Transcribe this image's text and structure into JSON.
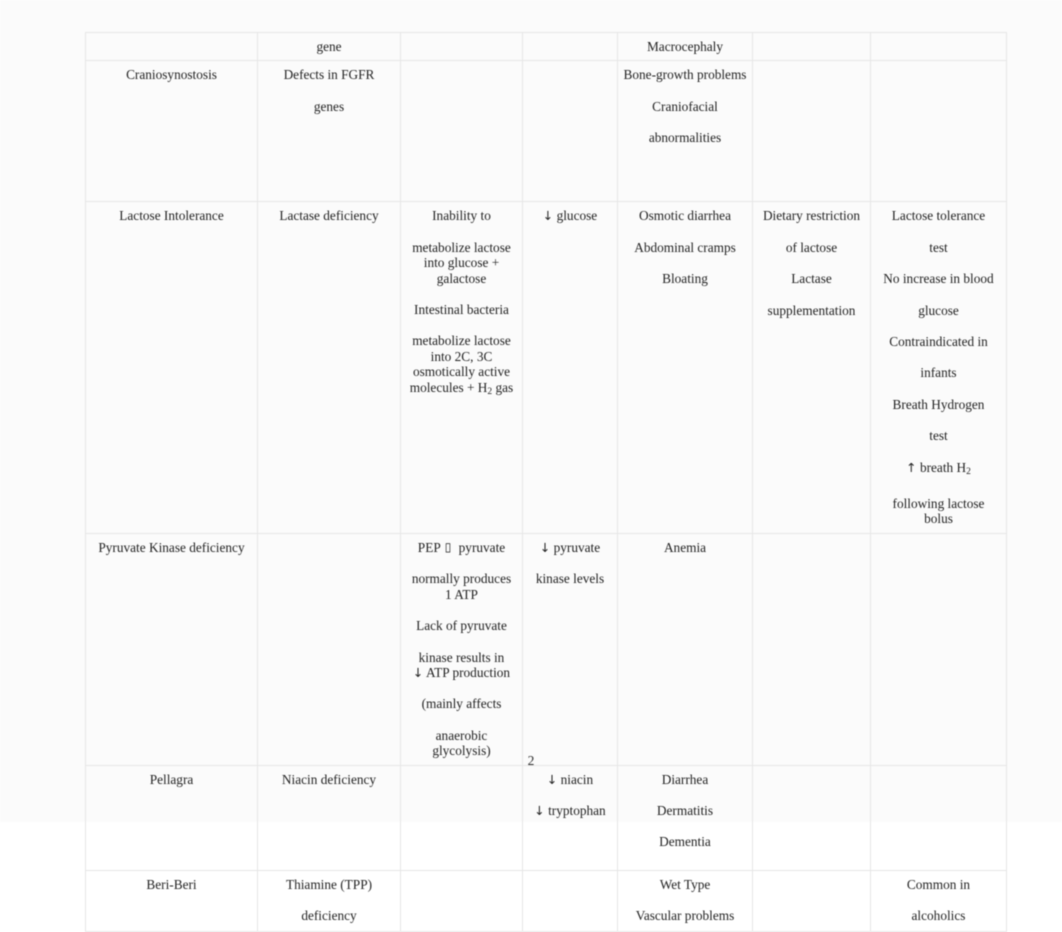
{
  "document": {
    "page_number": "2",
    "table": {
      "columns": [
        "disease",
        "cause",
        "mechanism",
        "labs",
        "signs-symptoms",
        "treatment",
        "spacer",
        "notes"
      ],
      "rows": [
        {
          "name": "row-partial-top",
          "cells": {
            "disease": [],
            "cause": [
              "gene"
            ],
            "mechanism": [],
            "labs": [],
            "signs": [
              "Macrocephaly"
            ],
            "treatment": [],
            "spacer": [],
            "notes": []
          }
        },
        {
          "name": "row-craniosynostosis",
          "cells": {
            "disease": [
              "Craniosynostosis"
            ],
            "cause": [
              "Defects in FGFR genes"
            ],
            "mechanism": [],
            "labs": [],
            "signs": [
              "Bone-growth problems",
              "Craniofacial abnormalities"
            ],
            "treatment": [],
            "spacer": [],
            "notes": []
          }
        },
        {
          "name": "row-lactose-intolerance",
          "cells": {
            "disease": [
              "Lactose Intolerance"
            ],
            "cause": [
              "Lactase deficiency"
            ],
            "mechanism": [
              "Inability to metabolize lactose into glucose + galactose",
              "Intestinal bacteria metabolize lactose into 2C, 3C osmotically active molecules + H2 gas"
            ],
            "labs": [
              "↓ glucose"
            ],
            "signs": [
              "Osmotic diarrhea",
              "Abdominal cramps",
              "Bloating"
            ],
            "treatment": [
              "Dietary restriction of lactose",
              "Lactase supplementation"
            ],
            "spacer": [],
            "notes": [
              "Lactose tolerance test",
              "No increase in blood glucose",
              "Contraindicated in infants",
              "Breath Hydrogen test",
              "↑ breath H2 following lactose bolus"
            ]
          }
        },
        {
          "name": "row-pyruvate-kinase-deficiency",
          "cells": {
            "disease": [
              "Pyruvate Kinase deficiency"
            ],
            "cause": [],
            "mechanism": [
              "PEP → pyruvate normally produces 1 ATP",
              "Lack of pyruvate kinase results in ↓ ATP production",
              "(mainly affects anaerobic glycolysis)"
            ],
            "labs": [
              "↓ pyruvate kinase levels"
            ],
            "signs": [
              "Anemia"
            ],
            "treatment": [],
            "spacer": [],
            "notes": []
          }
        },
        {
          "name": "row-pellagra",
          "cells": {
            "disease": [
              "Pellagra"
            ],
            "cause": [
              "Niacin deficiency"
            ],
            "mechanism": [],
            "labs": [
              "↓ niacin",
              "↓ tryptophan"
            ],
            "signs": [
              "Diarrhea",
              "Dermatitis",
              "Dementia"
            ],
            "treatment": [],
            "spacer": [],
            "notes": []
          }
        },
        {
          "name": "row-beri-beri",
          "cells": {
            "disease": [
              "Beri-Beri"
            ],
            "cause": [
              "Thiamine (TPP) deficiency"
            ],
            "mechanism": [],
            "labs": [],
            "signs": [
              "Wet Type",
              "Vascular problems"
            ],
            "treatment": [],
            "spacer": [],
            "notes": [
              "Common in alcoholics"
            ]
          }
        }
      ]
    },
    "text": {
      "gene": "gene",
      "macrocephaly": "Macrocephaly",
      "craniosynostosis": "Craniosynostosis",
      "defects_fgfr_l1": "Defects in FGFR",
      "defects_fgfr_l2": "genes",
      "bone_growth": "Bone-growth problems",
      "craniofacial_l1": "Craniofacial",
      "craniofacial_l2": "abnormalities",
      "lactose_intolerance": "Lactose Intolerance",
      "lactase_deficiency": "Lactase deficiency",
      "inability_l1": "Inability to",
      "inability_l2": "metabolize lactose",
      "inability_l3": "into glucose +",
      "inability_l4": "galactose",
      "bacteria_l1": "Intestinal bacteria",
      "bacteria_l2": "metabolize lactose",
      "bacteria_l3": "into 2C, 3C",
      "bacteria_l4": "osmotically active",
      "bacteria_l5_a": "molecules + H",
      "bacteria_l5_sub": "2",
      "bacteria_l5_b": " gas",
      "down_glucose_arrow": "↓",
      "down_glucose_text": "glucose",
      "osmotic_diarrhea": "Osmotic diarrhea",
      "abdominal_cramps": "Abdominal cramps",
      "bloating": "Bloating",
      "dietary_l1": "Dietary restriction",
      "dietary_l2": "of lactose",
      "lactase_supp_l1": "Lactase",
      "lactase_supp_l2": "supplementation",
      "lactose_tol_l1": "Lactose tolerance",
      "lactose_tol_l2": "test",
      "no_increase_l1": "No increase in blood",
      "no_increase_l2": "glucose",
      "contraindicated_l1": "Contraindicated in",
      "contraindicated_l2": "infants",
      "breath_h2_l1": "Breath Hydrogen",
      "breath_h2_l2": "test",
      "up_breath_arrow": "↑",
      "up_breath_a": " breath H",
      "up_breath_sub": "2",
      "up_breath_l2": "following lactose",
      "up_breath_l3": "bolus",
      "pyruvate_kinase_deficiency": "Pyruvate Kinase deficiency",
      "pep_a": "PEP",
      "pep_tofu": "▯",
      "pep_b": "pyruvate",
      "pep_l2": "normally produces",
      "pep_l3": "1 ATP",
      "lack_l1": "Lack of pyruvate",
      "lack_l2": "kinase results in",
      "lack_l3_arrow": "↓",
      "lack_l3_text": " ATP production",
      "mainly_l1": "(mainly affects",
      "mainly_l2": "anaerobic",
      "mainly_l3": "glycolysis)",
      "down_pk_arrow": "↓",
      "down_pk_l1": " pyruvate",
      "down_pk_l2": "kinase levels",
      "anemia": "Anemia",
      "pellagra": "Pellagra",
      "niacin_deficiency": "Niacin deficiency",
      "down_niacin_arrow": "↓",
      "down_niacin_text": " niacin",
      "down_tryptophan_arrow": "↓",
      "down_tryptophan_text": " tryptophan",
      "diarrhea": "Diarrhea",
      "dermatitis": "Dermatitis",
      "dementia": "Dementia",
      "beri_beri": "Beri-Beri",
      "thiamine_l1": "Thiamine (TPP)",
      "thiamine_l2": "deficiency",
      "wet_type": "Wet Type",
      "vascular_problems": "Vascular problems",
      "common_l1": "Common in",
      "common_l2": "alcoholics"
    }
  }
}
